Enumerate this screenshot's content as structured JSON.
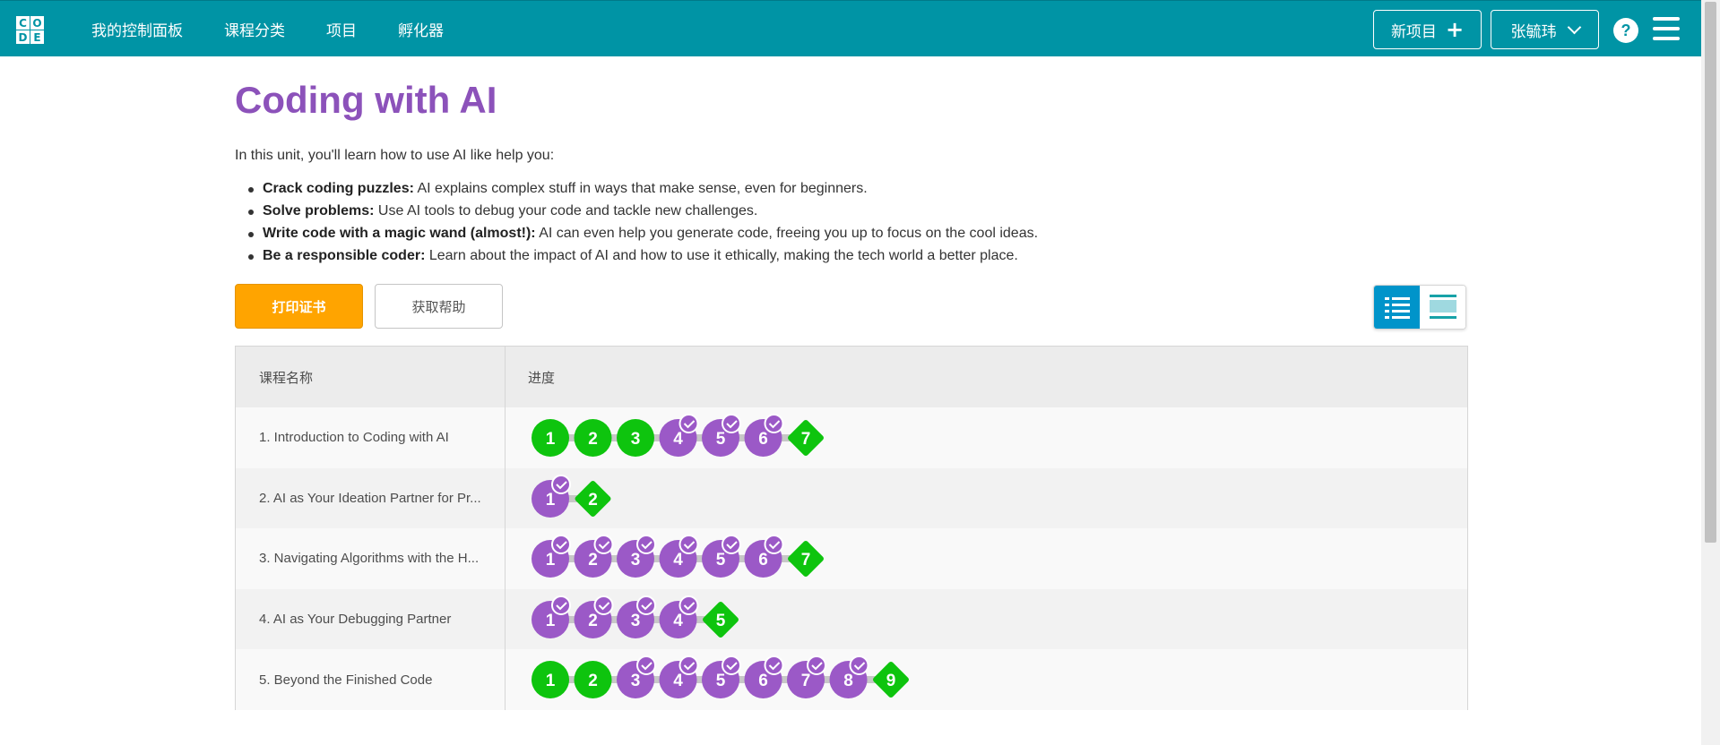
{
  "header": {
    "logo_letters": [
      "C",
      "O",
      "",
      "D",
      "E",
      ""
    ],
    "nav": [
      "我的控制面板",
      "课程分类",
      "项目",
      "孵化器"
    ],
    "new_project": "新项目",
    "user_name": "张毓玮",
    "help_label": "?",
    "colors": {
      "bar": "#0094a5"
    }
  },
  "unit": {
    "title": "Coding with AI",
    "intro": "In this unit, you'll learn how to use AI like help you:",
    "bullets": [
      {
        "bold": "Crack coding puzzles:",
        "text": " AI explains complex stuff in ways that make sense, even for beginners."
      },
      {
        "bold": "Solve problems:",
        "text": " Use AI tools to debug your code and tackle new challenges."
      },
      {
        "bold": "Write code with a magic wand (almost!):",
        "text": " AI can even help you generate code, freeing you up to focus on the cool ideas."
      },
      {
        "bold": "Be a responsible coder:",
        "text": " Learn about the impact of AI and how to use it ethically, making the tech world a better place."
      }
    ]
  },
  "actions": {
    "print_certificate": "打印证书",
    "get_help": "获取帮助",
    "view_toggle": [
      "list-view-icon",
      "detail-view-icon"
    ]
  },
  "table": {
    "col_name": "课程名称",
    "col_progress": "进度",
    "colors": {
      "completed": "#0ec40e",
      "in_progress": "#9b59c7",
      "track": "#c7c7c7",
      "check": "#ffffff"
    },
    "lessons": [
      {
        "name": "1. Introduction to Coding with AI",
        "bubbles": [
          {
            "n": "1",
            "state": "completed",
            "shape": "circle",
            "check": false
          },
          {
            "n": "2",
            "state": "completed",
            "shape": "circle",
            "check": false
          },
          {
            "n": "3",
            "state": "completed",
            "shape": "circle",
            "check": false
          },
          {
            "n": "4",
            "state": "in_progress",
            "shape": "circle",
            "check": true
          },
          {
            "n": "5",
            "state": "in_progress",
            "shape": "circle",
            "check": true
          },
          {
            "n": "6",
            "state": "in_progress",
            "shape": "circle",
            "check": true
          },
          {
            "n": "7",
            "state": "completed",
            "shape": "diamond",
            "check": false
          }
        ]
      },
      {
        "name": "2. AI as Your Ideation Partner for Pr...",
        "bubbles": [
          {
            "n": "1",
            "state": "in_progress",
            "shape": "circle",
            "check": true
          },
          {
            "n": "2",
            "state": "completed",
            "shape": "diamond",
            "check": false
          }
        ]
      },
      {
        "name": "3. Navigating Algorithms with the H...",
        "bubbles": [
          {
            "n": "1",
            "state": "in_progress",
            "shape": "circle",
            "check": true
          },
          {
            "n": "2",
            "state": "in_progress",
            "shape": "circle",
            "check": true
          },
          {
            "n": "3",
            "state": "in_progress",
            "shape": "circle",
            "check": true
          },
          {
            "n": "4",
            "state": "in_progress",
            "shape": "circle",
            "check": true
          },
          {
            "n": "5",
            "state": "in_progress",
            "shape": "circle",
            "check": true
          },
          {
            "n": "6",
            "state": "in_progress",
            "shape": "circle",
            "check": true
          },
          {
            "n": "7",
            "state": "completed",
            "shape": "diamond",
            "check": false
          }
        ]
      },
      {
        "name": "4. AI as Your Debugging Partner",
        "bubbles": [
          {
            "n": "1",
            "state": "in_progress",
            "shape": "circle",
            "check": true
          },
          {
            "n": "2",
            "state": "in_progress",
            "shape": "circle",
            "check": true
          },
          {
            "n": "3",
            "state": "in_progress",
            "shape": "circle",
            "check": true
          },
          {
            "n": "4",
            "state": "in_progress",
            "shape": "circle",
            "check": true
          },
          {
            "n": "5",
            "state": "completed",
            "shape": "diamond",
            "check": false
          }
        ]
      },
      {
        "name": "5. Beyond the Finished Code",
        "bubbles": [
          {
            "n": "1",
            "state": "completed",
            "shape": "circle",
            "check": false
          },
          {
            "n": "2",
            "state": "completed",
            "shape": "circle",
            "check": false
          },
          {
            "n": "3",
            "state": "in_progress",
            "shape": "circle",
            "check": true
          },
          {
            "n": "4",
            "state": "in_progress",
            "shape": "circle",
            "check": true
          },
          {
            "n": "5",
            "state": "in_progress",
            "shape": "circle",
            "check": true
          },
          {
            "n": "6",
            "state": "in_progress",
            "shape": "circle",
            "check": true
          },
          {
            "n": "7",
            "state": "in_progress",
            "shape": "circle",
            "check": true
          },
          {
            "n": "8",
            "state": "in_progress",
            "shape": "circle",
            "check": true
          },
          {
            "n": "9",
            "state": "completed",
            "shape": "diamond",
            "check": false
          }
        ]
      }
    ]
  }
}
